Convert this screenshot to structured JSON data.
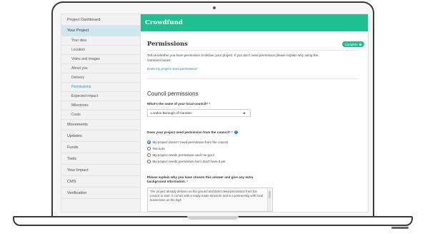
{
  "sidebar": {
    "items": [
      {
        "label": "Project Dashboard"
      },
      {
        "label": "Your Project"
      },
      {
        "label": "Your idea"
      },
      {
        "label": "Location"
      },
      {
        "label": "Video and images"
      },
      {
        "label": "About you"
      },
      {
        "label": "Delivery"
      },
      {
        "label": "Permissions"
      },
      {
        "label": "Expected impact"
      },
      {
        "label": "Milestones"
      },
      {
        "label": "Costs"
      },
      {
        "label": "Movements"
      },
      {
        "label": "Updates"
      },
      {
        "label": "Funds"
      },
      {
        "label": "Tools"
      },
      {
        "label": "Your Impact"
      },
      {
        "label": "CMS"
      },
      {
        "label": "Verification"
      }
    ]
  },
  "header": {
    "brand": "Crowdfund"
  },
  "main": {
    "title": "Permissions",
    "status_badge": "Complete",
    "intro": "Tell us whether you have permission to deliver your project. If you don't need permission please explain why using the comment boxes.",
    "help_link": "Does my project need permission?",
    "section_title": "Council permissions",
    "council_label": "What's the name of your local council?",
    "council_value": "London Borough of Camden",
    "permission_question": "Does your project need permission from the council?",
    "required_mark": "*",
    "options": [
      {
        "label": "My project doesn't need permission from the council",
        "checked": true
      },
      {
        "label": "Not sure",
        "checked": false
      },
      {
        "label": "My project needs permission and I've got it",
        "checked": false
      },
      {
        "label": "My project needs permission but I don't have it yet",
        "checked": false
      }
    ],
    "explain_label_1": "Please explain why you have chosen this answer and give any extra",
    "explain_label_2": "background information.",
    "explain_text": "The project already delivers on the ground and didn't need permission from the council to start. It comes with a ready made structure and is a partnership with local businesses on the high"
  },
  "colors": {
    "brand": "#1fbf8f",
    "link": "#1a7fc4",
    "sidebar_active": "#cfe7ef",
    "required": "#d8262b"
  }
}
